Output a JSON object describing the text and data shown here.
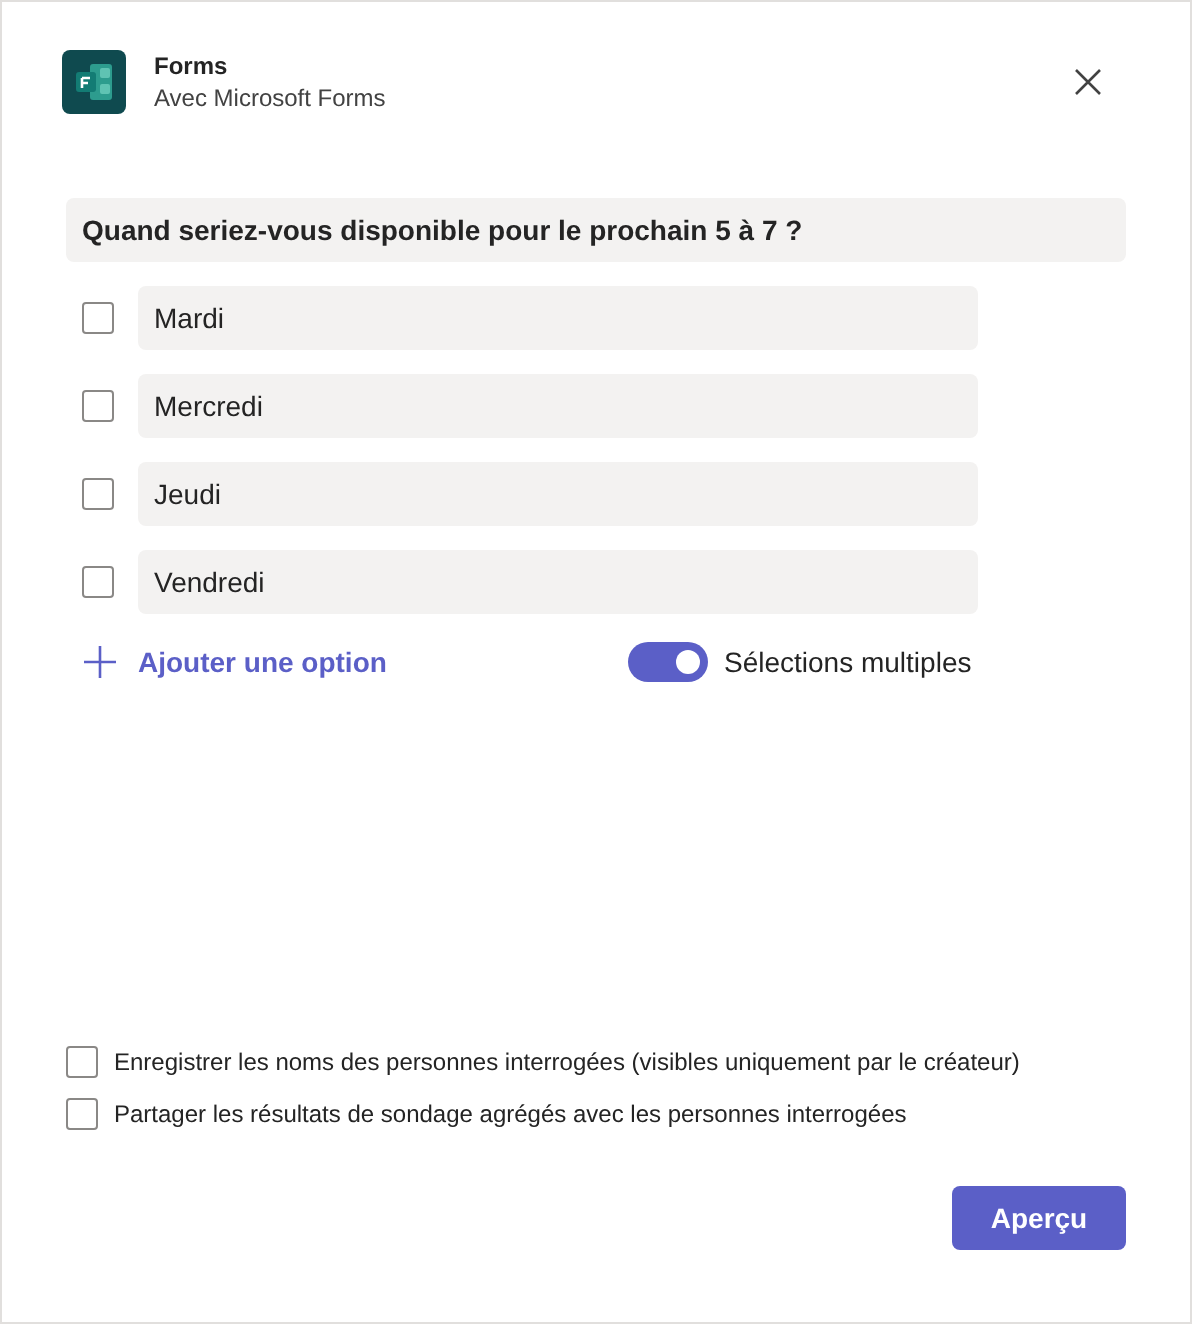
{
  "header": {
    "title": "Forms",
    "subtitle": "Avec Microsoft Forms"
  },
  "question": {
    "value": "Quand seriez-vous disponible pour le prochain 5 à 7 ?"
  },
  "options": [
    {
      "value": "Mardi",
      "checked": false
    },
    {
      "value": "Mercredi",
      "checked": false
    },
    {
      "value": "Jeudi",
      "checked": false
    },
    {
      "value": "Vendredi",
      "checked": false
    }
  ],
  "add_option": {
    "label": "Ajouter une option"
  },
  "multiple_selection": {
    "label": "Sélections multiples",
    "on": true
  },
  "settings": [
    {
      "label": "Enregistrer les noms des personnes interrogées (visibles uniquement par le créateur)",
      "checked": false
    },
    {
      "label": "Partager les résultats de sondage agrégés avec les personnes interrogées",
      "checked": false
    }
  ],
  "buttons": [
    {
      "label": "Aperçu"
    }
  ]
}
